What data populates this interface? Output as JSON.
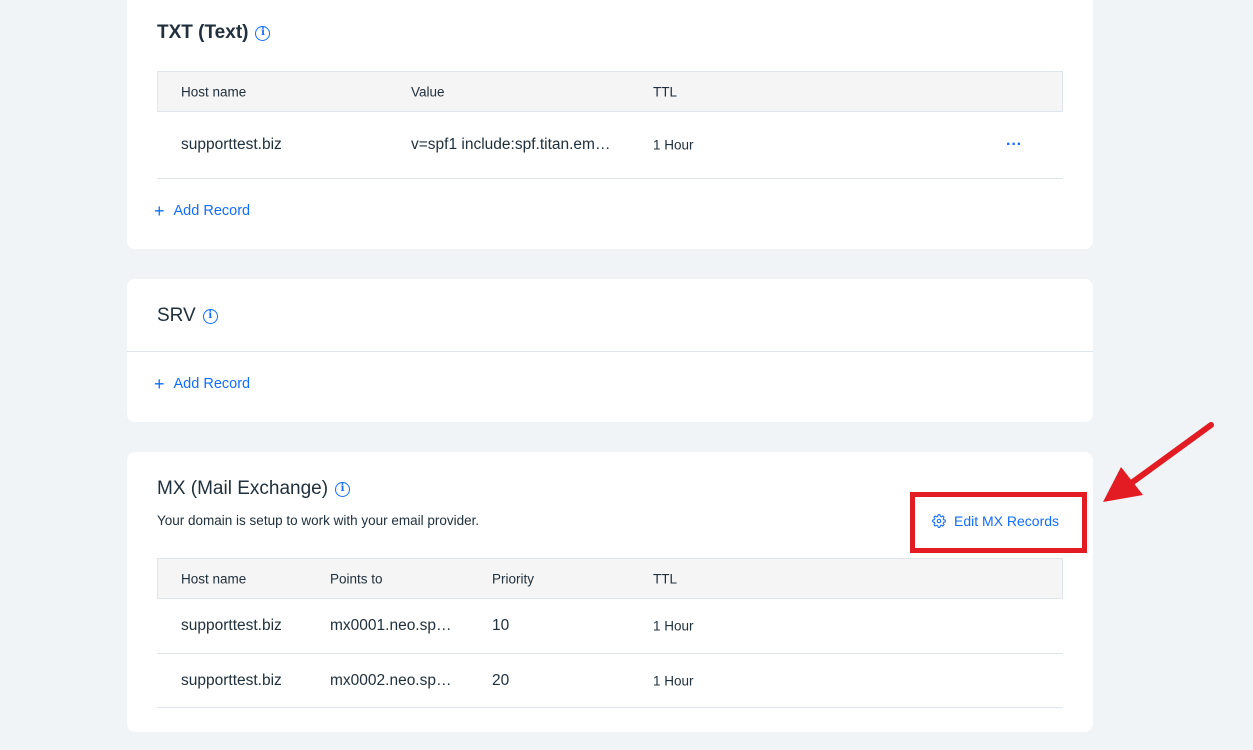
{
  "txt": {
    "title": "TXT (Text)",
    "info_icon": "info-icon",
    "headers": {
      "host": "Host name",
      "value": "Value",
      "ttl": "TTL"
    },
    "rows": [
      {
        "host": "supporttest.biz",
        "value": "v=spf1 include:spf.titan.em…",
        "ttl": "1 Hour",
        "menu": "···"
      }
    ],
    "add_record": "Add Record"
  },
  "srv": {
    "title": "SRV",
    "info_icon": "info-icon",
    "add_record": "Add Record"
  },
  "mx": {
    "title": "MX (Mail Exchange)",
    "info_icon": "info-icon",
    "subtitle": "Your domain is setup to work with your email provider.",
    "edit_label": "Edit MX Records",
    "edit_icon": "gear-icon",
    "headers": {
      "host": "Host name",
      "points": "Points to",
      "priority": "Priority",
      "ttl": "TTL"
    },
    "rows": [
      {
        "host": "supporttest.biz",
        "points": "mx0001.neo.sp…",
        "priority": "10",
        "ttl": "1 Hour"
      },
      {
        "host": "supporttest.biz",
        "points": "mx0002.neo.sp…",
        "priority": "20",
        "ttl": "1 Hour"
      }
    ]
  },
  "colors": {
    "background": "#f0f4f7",
    "accent": "#116dff",
    "annotation": "#e31b23",
    "text": "#20303c"
  }
}
